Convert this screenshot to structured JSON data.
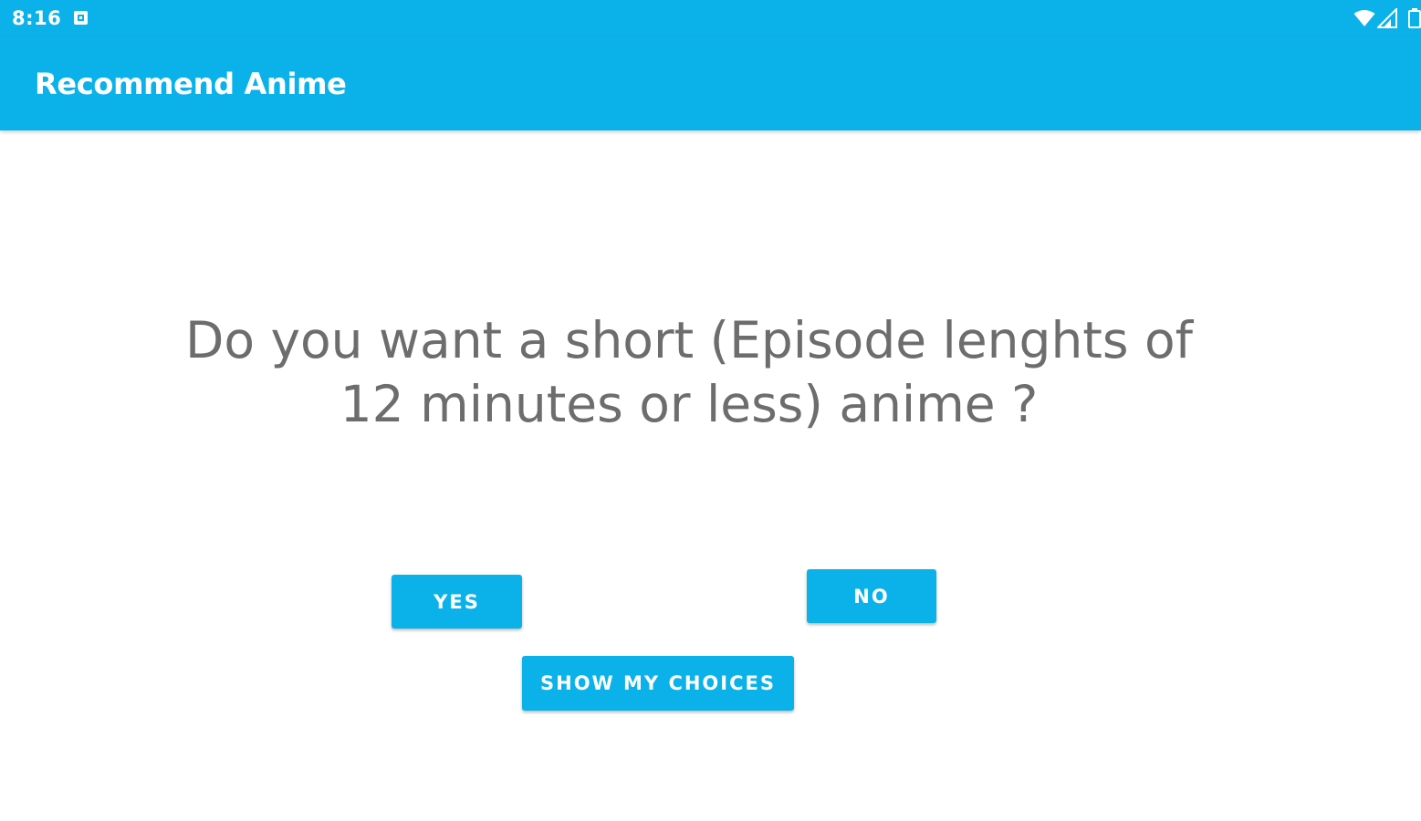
{
  "status_bar": {
    "time": "8:16",
    "notification_icon": "app-notification-icon",
    "wifi_icon": "wifi-icon",
    "signal_icon": "cell-signal-icon",
    "battery_icon": "battery-icon",
    "color": "#0bb2ea"
  },
  "app_bar": {
    "title": "Recommend Anime",
    "color": "#0bb2ea"
  },
  "main": {
    "question_line1": "Do you want a short (Episode lenghts of",
    "question_line2": "12 minutes or less) anime ?",
    "question_color": "#6d6d6d"
  },
  "buttons": {
    "yes_label": "YES",
    "no_label": "NO",
    "show_choices_label": "SHOW MY CHOICES",
    "color": "#0bb2ea"
  }
}
